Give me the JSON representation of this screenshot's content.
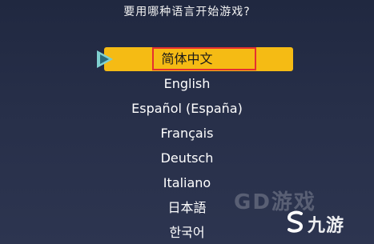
{
  "prompt": "要用哪种语言开始游戏?",
  "languages": [
    {
      "label": "简体中文",
      "selected": true
    },
    {
      "label": "English",
      "selected": false
    },
    {
      "label": "Español (España)",
      "selected": false
    },
    {
      "label": "Français",
      "selected": false
    },
    {
      "label": "Deutsch",
      "selected": false
    },
    {
      "label": "Italiano",
      "selected": false
    },
    {
      "label": "日本語",
      "selected": false
    },
    {
      "label": "한국어",
      "selected": false
    }
  ],
  "watermark": {
    "faded_text": "GD游戏",
    "logo_text": "九游"
  },
  "colors": {
    "selection_bar": "#f5bb14",
    "highlight_border": "#e53030",
    "cursor": "#7fd0d0",
    "background": "#272f49"
  },
  "icons": {
    "cursor": "play-cursor-icon",
    "logo": "jiuyou-logo-icon"
  }
}
